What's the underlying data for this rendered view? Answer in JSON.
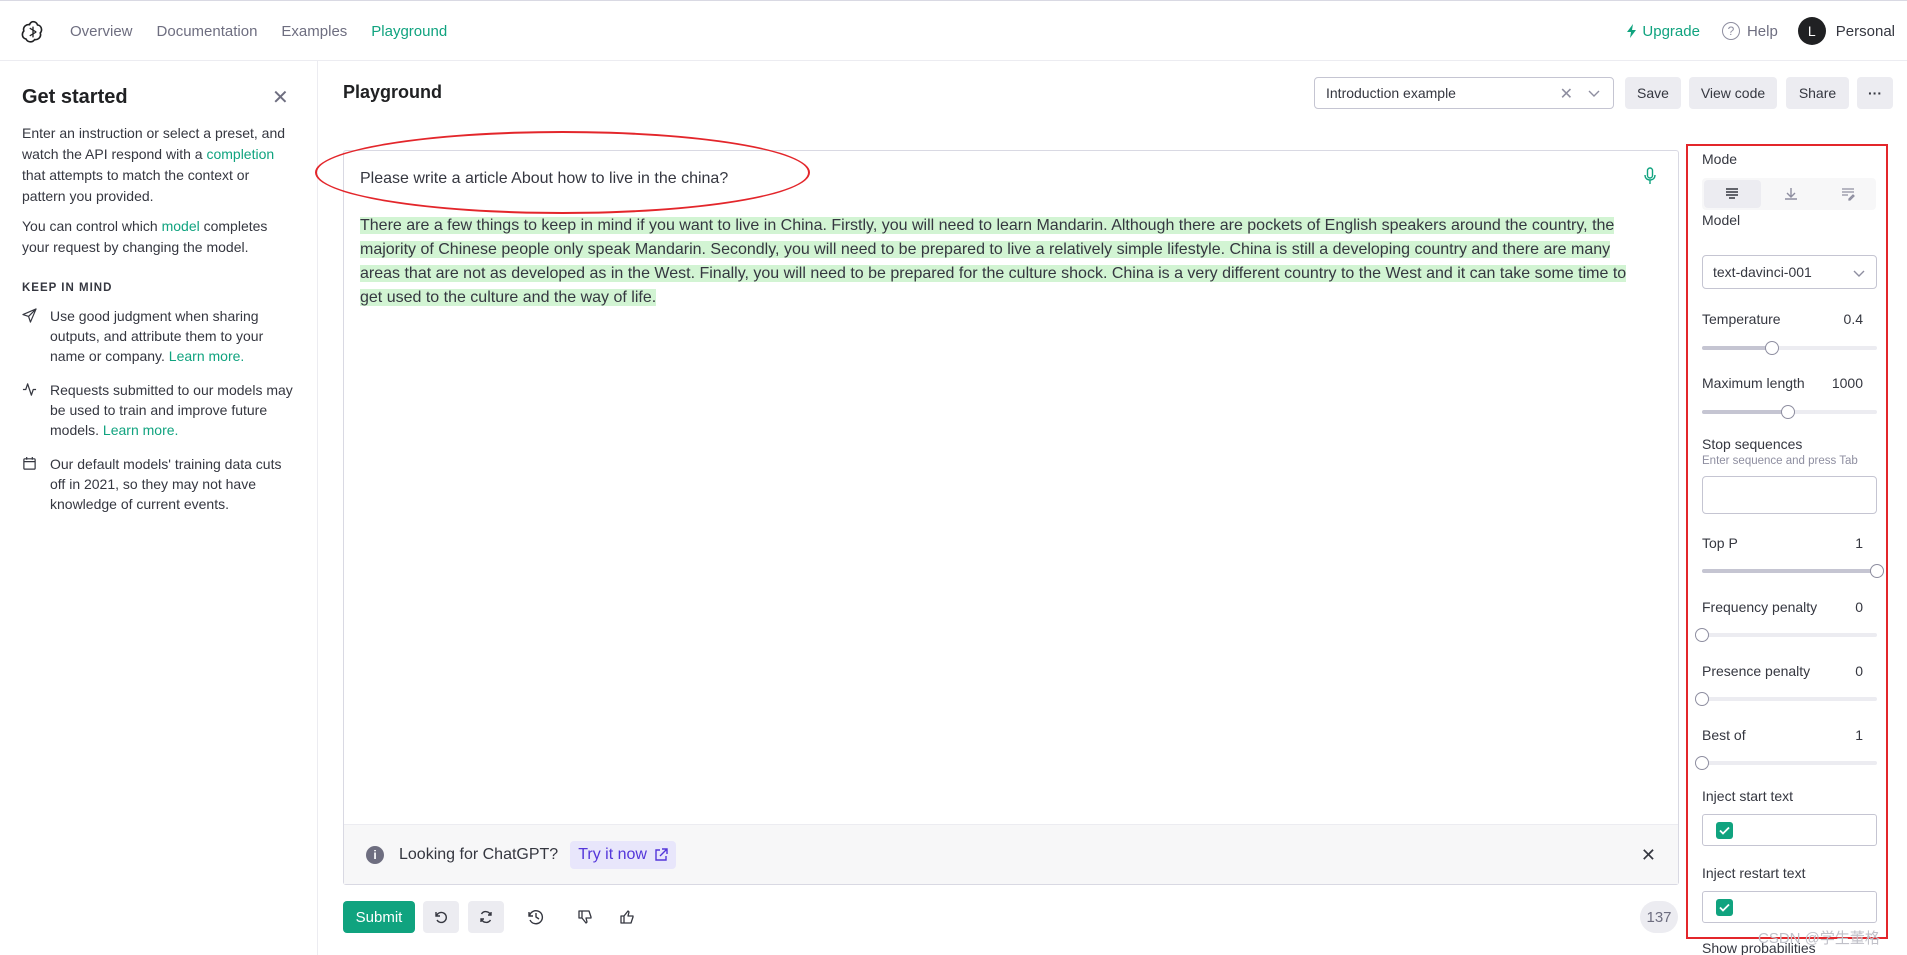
{
  "nav": {
    "links": [
      "Overview",
      "Documentation",
      "Examples",
      "Playground"
    ],
    "upgrade": "Upgrade",
    "help": "Help",
    "avatar_initial": "L",
    "account": "Personal"
  },
  "sidebar": {
    "title": "Get started",
    "intro_pre": "Enter an instruction or select a preset, and watch the API respond with a ",
    "intro_link": "completion",
    "intro_post": " that attempts to match the context or pattern you provided.",
    "model_pre": "You can control which ",
    "model_link": "model",
    "model_post": " completes your request by changing the model.",
    "keep_heading": "KEEP IN MIND",
    "items": [
      {
        "icon": "send-icon",
        "text": "Use good judgment when sharing outputs, and attribute them to your name or company. ",
        "link": "Learn more."
      },
      {
        "icon": "activity-icon",
        "text": "Requests submitted to our models may be used to train and improve future models. ",
        "link": "Learn more."
      },
      {
        "icon": "calendar-icon",
        "text": "Our default models' training data cuts off in 2021, so they may not have knowledge of current events.",
        "link": ""
      }
    ]
  },
  "header": {
    "title": "Playground",
    "preset_value": "Introduction example",
    "save": "Save",
    "view_code": "View code",
    "share": "Share",
    "more": "···"
  },
  "editor": {
    "prompt": "Please write a article About how to live in the china?",
    "completion": "There are a few things to keep in mind if you want to live in China. Firstly, you will need to learn Mandarin. Although there are pockets of English speakers around the country, the majority of Chinese people only speak Mandarin. Secondly, you will need to be prepared to live a relatively simple lifestyle. China is still a developing country and there are many areas that are not as developed as in the West. Finally, you will need to be prepared for the culture shock. China is a very different country to the West and it can take some time to get used to the culture and the way of life.",
    "banner_text": "Looking for ChatGPT?",
    "banner_link": "Try it now"
  },
  "actions": {
    "submit": "Submit",
    "token_count": "137"
  },
  "settings": {
    "mode_label": "Mode",
    "model_label": "Model",
    "model_value": "text-davinci-001",
    "temperature_label": "Temperature",
    "temperature_value": "0.4",
    "temperature_level": 0.4,
    "max_length_label": "Maximum length",
    "max_length_value": "1000",
    "max_length_level": 0.49,
    "stop_label": "Stop sequences",
    "stop_hint": "Enter sequence and press Tab",
    "top_p_label": "Top P",
    "top_p_value": "1",
    "top_p_level": 1,
    "freq_label": "Frequency penalty",
    "freq_value": "0",
    "freq_level": 0,
    "presence_label": "Presence penalty",
    "presence_value": "0",
    "presence_level": 0,
    "best_of_label": "Best of",
    "best_of_value": "1",
    "best_of_level": 0,
    "inject_start_label": "Inject start text",
    "inject_restart_label": "Inject restart text",
    "show_prob_label": "Show probabilities"
  },
  "watermark": "CSDN @学生董格",
  "colors": {
    "accent": "#10a37f",
    "highlight": "#d2f4d3",
    "annotation": "#e3262b"
  }
}
